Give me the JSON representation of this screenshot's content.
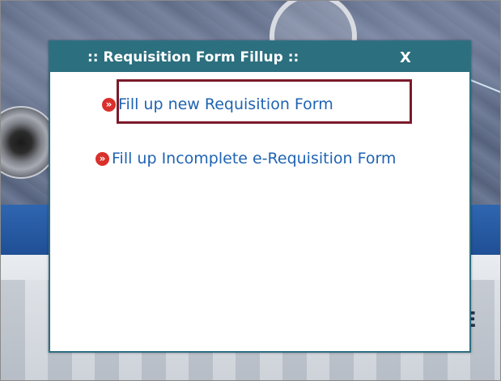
{
  "popup": {
    "title": ":: Requisition Form Fillup ::",
    "close_label": "X",
    "links": [
      {
        "label": "Fill up new Requisition Form",
        "icon": "double-chevron-right-icon"
      },
      {
        "label": "Fill up Incomplete e-Requisition Form",
        "icon": "double-chevron-right-icon"
      }
    ],
    "bullet_glyph": "»"
  },
  "background": {
    "logo_fragment": "E"
  },
  "colors": {
    "popup_header": "#2c6f7f",
    "link_text": "#1f63b2",
    "bullet": "#d9302b",
    "highlight_border": "#7c1a2a",
    "navbar": "#2f66b0"
  }
}
